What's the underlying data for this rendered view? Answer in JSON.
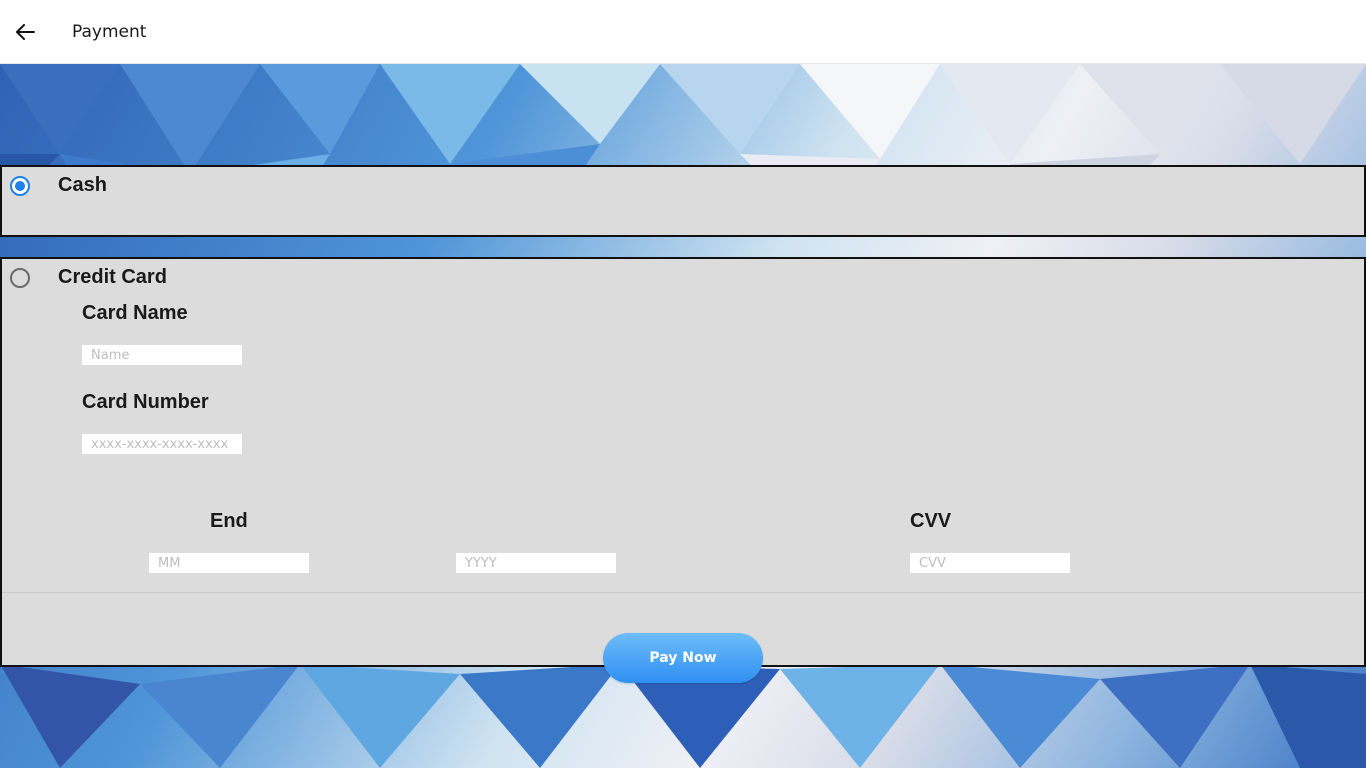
{
  "window": {
    "title": "Payment",
    "back_icon": "arrow-left-icon"
  },
  "colors": {
    "accent": "#1e80e8",
    "panel_bg": "#dcdcdc",
    "button": "#3a95f3"
  },
  "payment_options": {
    "cash": {
      "label": "Cash",
      "selected": true
    },
    "credit_card": {
      "label": "Credit Card",
      "selected": false,
      "card_name": {
        "label": "Card Name",
        "placeholder": "Name",
        "value": ""
      },
      "card_number": {
        "label": "Card Number",
        "placeholder": "xxxx-xxxx-xxxx-xxxx",
        "value": ""
      },
      "end": {
        "label": "End",
        "month_placeholder": "MM",
        "year_placeholder": "YYYY"
      },
      "cvv": {
        "label": "CVV",
        "placeholder": "CVV"
      }
    }
  },
  "actions": {
    "pay_now_label": "Pay Now"
  }
}
